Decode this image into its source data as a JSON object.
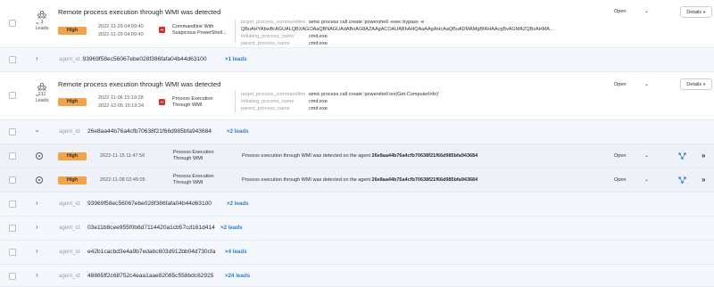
{
  "alerts": [
    {
      "lead_count": "3",
      "leads_label": "Leads",
      "title": "Remote process execution through WMI was detected",
      "severity": "High",
      "date_first": "2022-11-29 04:09:40",
      "date_last": "2022-11-29 04:09:40",
      "rule_name": "Commandline With Suspicious PowerShell...",
      "fields": [
        {
          "key": "target_process_commandline",
          "value": "wmic process call create 'powershell -exec bypass -e QBuAHYAbwBrAGUALQBXAGOAaQBNAGUAdABoAG8AZAAgACOAUABhAHQAaAAgAHcAaQBuADMAMgBfAHAAcgBvAGMAZQBzAHMA..."
        },
        {
          "key": "initiating_process_name",
          "value": "cmd.exe"
        },
        {
          "key": "parent_process_name",
          "value": "cmd.exe"
        }
      ],
      "status": "Open",
      "details_label": "Details"
    },
    {
      "lead_count": "211",
      "leads_label": "Leads",
      "title": "Remote process execution through WMI was detected",
      "severity": "High",
      "date_first": "2022-11-06 15:19:28",
      "date_last": "2022-12-05 15:19:24",
      "rule_name": "Process Execution Through WMI",
      "fields": [
        {
          "key": "target_process_commandline",
          "value": "wmic process call create 'powershell iex(Get-ComputerInfo)'"
        },
        {
          "key": "initiating_process_name",
          "value": "cmd.exe"
        },
        {
          "key": "parent_process_name",
          "value": "cmd.exe"
        }
      ],
      "status": "Open",
      "details_label": "Details"
    }
  ],
  "agent_label": "agent_id:",
  "agents": [
    {
      "id": "93969f58ec56067ebe028f386fafa04b44d63100",
      "leads": "×1 leads"
    },
    {
      "id": "26e8aa44b76a4cfb70638f21f66d985bfa943684",
      "leads": "×2 leads"
    },
    {
      "id": "93969f58ec56067ebe028f386fafa04b44d63100",
      "leads": "×2 leads"
    },
    {
      "id": "03e11b8cee955f0b6d7114420a1cb57cd161d414",
      "leads": "×2 leads"
    },
    {
      "id": "e42b1cacbd3e4a9b7edabc603d912bb04d730cfa",
      "leads": "×4 leads"
    },
    {
      "id": "48865ff2c68752c4eaa1aae82085c558bdc62925",
      "leads": "×24 leads"
    }
  ],
  "leads": [
    {
      "severity": "High",
      "date": "2022-11-15 11:47:56",
      "rule_name": "Process Execution Through WMI",
      "desc_prefix": "Process execution through WMI was detected on the agent",
      "desc_agent": "26e8aa44b76a4cfb70638f21f66d985bfa943684",
      "status": "Open"
    },
    {
      "severity": "High",
      "date": "2022-11-08 02:45:05",
      "rule_name": "Process Execution Through WMI",
      "desc_prefix": "Process execution through WMI was detected on the agent",
      "desc_agent": "26e8aa44b76a4cfb70638f21f66d985bfa943684",
      "status": "Open"
    }
  ],
  "colors": {
    "severity_high": "#f3a247",
    "link_blue": "#2f7fd1",
    "rule_icon_red": "#d9342b",
    "agent_row_bg": "#f4f7fb",
    "lead_row_bg": "#eef2f8"
  },
  "icons": {
    "leads": "people-group-icon",
    "rule": "red-rule-icon",
    "graph": "graph-nodes-icon",
    "open_lead": "eye-icon",
    "expand": "double-chevron-right-icon"
  }
}
